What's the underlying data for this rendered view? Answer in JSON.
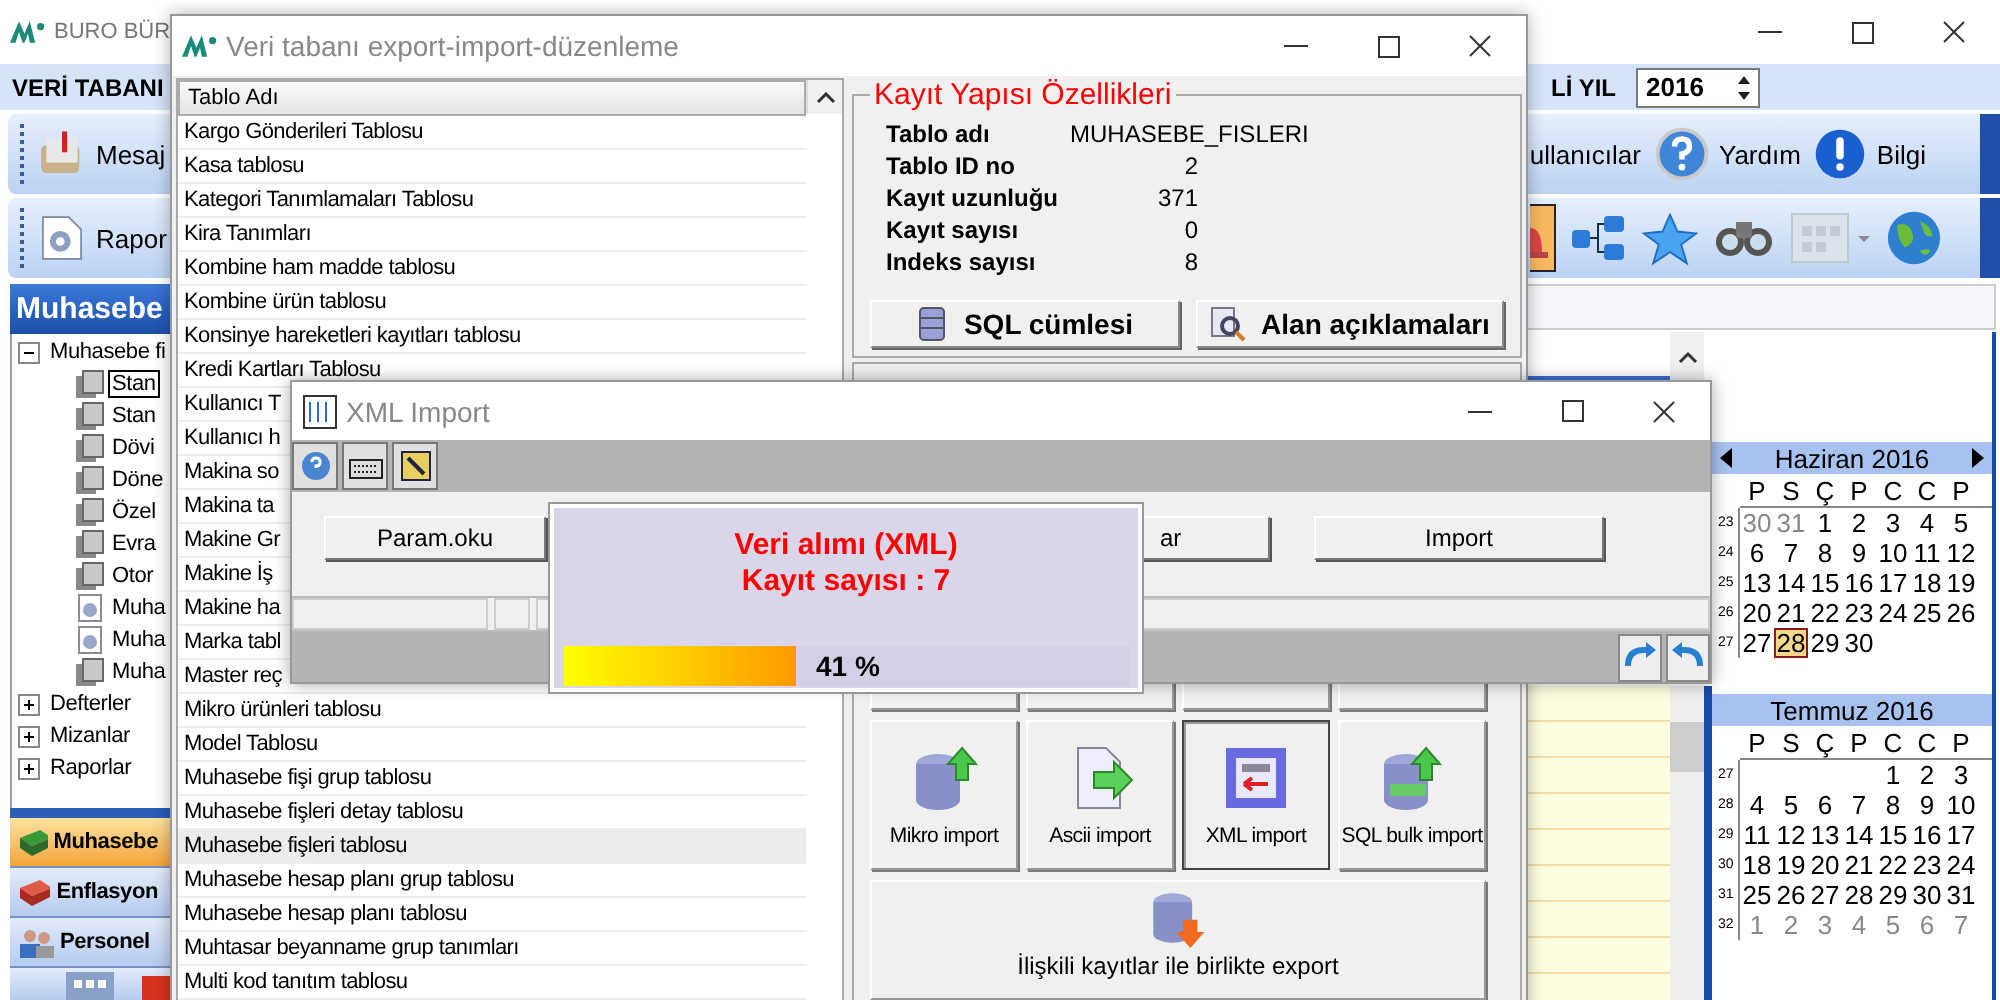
{
  "main_window": {
    "title": "BURO BÜR",
    "menu_label": "VERİ TABANI",
    "year_label": "Lİ YIL",
    "year": "2016",
    "toolbar_left": "Mesaj",
    "toolbar_right": [
      "ullanıcılar",
      "Yardım",
      "Bilgi"
    ],
    "toolbar2_left": "Rapor",
    "toolbar2_icons": [
      {
        "kind": "bell",
        "selected": true
      },
      {
        "kind": "tree",
        "selected": false
      },
      {
        "kind": "star",
        "selected": false
      },
      {
        "kind": "binoculars",
        "selected": false
      },
      {
        "kind": "calendar",
        "selected": false
      },
      {
        "kind": "globe",
        "selected": false
      }
    ],
    "panel_title": "Muhasebe",
    "tree": [
      {
        "label": "Muhasebe fi",
        "expanded": true,
        "selected": false,
        "children": [
          {
            "label": "Stan",
            "kind": "table",
            "selected": true
          },
          {
            "label": "Stan",
            "kind": "table",
            "selected": false
          },
          {
            "label": "Dövi",
            "kind": "table",
            "selected": false
          },
          {
            "label": "Döne",
            "kind": "table",
            "selected": false
          },
          {
            "label": "Özel",
            "kind": "table",
            "selected": false
          },
          {
            "label": "Evra",
            "kind": "table",
            "selected": false
          },
          {
            "label": "Otor",
            "kind": "table",
            "selected": false
          },
          {
            "label": "Muha",
            "kind": "report",
            "selected": false
          },
          {
            "label": "Muha",
            "kind": "report",
            "selected": false
          },
          {
            "label": "Muha",
            "kind": "table",
            "selected": false
          }
        ]
      },
      {
        "label": "Defterler",
        "expanded": false,
        "selected": false
      },
      {
        "label": "Mizanlar",
        "expanded": false,
        "selected": false
      },
      {
        "label": "Raporlar",
        "expanded": false,
        "selected": false
      }
    ],
    "nav": [
      {
        "label": "Muhasebe",
        "kind": "green-book",
        "selected": true
      },
      {
        "label": "Enflasyon",
        "kind": "red-book",
        "selected": false
      },
      {
        "label": "Personel",
        "kind": "people",
        "selected": false
      }
    ],
    "calendar": {
      "months": [
        {
          "title": "Haziran 2016",
          "nav": true,
          "weekdays": [
            "P",
            "S",
            "Ç",
            "P",
            "C",
            "C",
            "P"
          ],
          "weeks": [
            {
              "no": "23",
              "days": [
                {
                  "t": "30",
                  "muted": true,
                  "selected": false
                },
                {
                  "t": "31",
                  "muted": true,
                  "selected": false
                },
                {
                  "t": "1",
                  "muted": false,
                  "selected": false
                },
                {
                  "t": "2",
                  "muted": false,
                  "selected": false
                },
                {
                  "t": "3",
                  "muted": false,
                  "selected": false
                },
                {
                  "t": "4",
                  "muted": false,
                  "selected": false
                },
                {
                  "t": "5",
                  "muted": false,
                  "selected": false
                }
              ]
            },
            {
              "no": "24",
              "days": [
                {
                  "t": "6",
                  "muted": false,
                  "selected": false
                },
                {
                  "t": "7",
                  "muted": false,
                  "selected": false
                },
                {
                  "t": "8",
                  "muted": false,
                  "selected": false
                },
                {
                  "t": "9",
                  "muted": false,
                  "selected": false
                },
                {
                  "t": "10",
                  "muted": false,
                  "selected": false
                },
                {
                  "t": "11",
                  "muted": false,
                  "selected": false
                },
                {
                  "t": "12",
                  "muted": false,
                  "selected": false
                }
              ]
            },
            {
              "no": "25",
              "days": [
                {
                  "t": "13",
                  "muted": false,
                  "selected": false
                },
                {
                  "t": "14",
                  "muted": false,
                  "selected": false
                },
                {
                  "t": "15",
                  "muted": false,
                  "selected": false
                },
                {
                  "t": "16",
                  "muted": false,
                  "selected": false
                },
                {
                  "t": "17",
                  "muted": false,
                  "selected": false
                },
                {
                  "t": "18",
                  "muted": false,
                  "selected": false
                },
                {
                  "t": "19",
                  "muted": false,
                  "selected": false
                }
              ]
            },
            {
              "no": "26",
              "days": [
                {
                  "t": "20",
                  "muted": false,
                  "selected": false
                },
                {
                  "t": "21",
                  "muted": false,
                  "selected": false
                },
                {
                  "t": "22",
                  "muted": false,
                  "selected": false
                },
                {
                  "t": "23",
                  "muted": false,
                  "selected": false
                },
                {
                  "t": "24",
                  "muted": false,
                  "selected": false
                },
                {
                  "t": "25",
                  "muted": false,
                  "selected": false
                },
                {
                  "t": "26",
                  "muted": false,
                  "selected": false
                }
              ]
            },
            {
              "no": "27",
              "days": [
                {
                  "t": "27",
                  "muted": false,
                  "selected": false
                },
                {
                  "t": "28",
                  "muted": false,
                  "selected": true
                },
                {
                  "t": "29",
                  "muted": false,
                  "selected": false
                },
                {
                  "t": "30",
                  "muted": false,
                  "selected": false
                }
              ]
            }
          ]
        },
        {
          "title": "Temmuz 2016",
          "nav": false,
          "weekdays": [
            "P",
            "S",
            "Ç",
            "P",
            "C",
            "C",
            "P"
          ],
          "weeks": [
            {
              "no": "27",
              "days": [
                {
                  "t": "1",
                  "muted": false,
                  "selected": false
                },
                {
                  "t": "2",
                  "muted": false,
                  "selected": false
                },
                {
                  "t": "3",
                  "muted": false,
                  "selected": false
                }
              ]
            },
            {
              "no": "28",
              "days": [
                {
                  "t": "4",
                  "muted": false,
                  "selected": false
                },
                {
                  "t": "5",
                  "muted": false,
                  "selected": false
                },
                {
                  "t": "6",
                  "muted": false,
                  "selected": false
                },
                {
                  "t": "7",
                  "muted": false,
                  "selected": false
                },
                {
                  "t": "8",
                  "muted": false,
                  "selected": false
                },
                {
                  "t": "9",
                  "muted": false,
                  "selected": false
                },
                {
                  "t": "10",
                  "muted": false,
                  "selected": false
                }
              ]
            },
            {
              "no": "29",
              "days": [
                {
                  "t": "11",
                  "muted": false,
                  "selected": false
                },
                {
                  "t": "12",
                  "muted": false,
                  "selected": false
                },
                {
                  "t": "13",
                  "muted": false,
                  "selected": false
                },
                {
                  "t": "14",
                  "muted": false,
                  "selected": false
                },
                {
                  "t": "15",
                  "muted": false,
                  "selected": false
                },
                {
                  "t": "16",
                  "muted": false,
                  "selected": false
                },
                {
                  "t": "17",
                  "muted": false,
                  "selected": false
                }
              ]
            },
            {
              "no": "30",
              "days": [
                {
                  "t": "18",
                  "muted": false,
                  "selected": false
                },
                {
                  "t": "19",
                  "muted": false,
                  "selected": false
                },
                {
                  "t": "20",
                  "muted": false,
                  "selected": false
                },
                {
                  "t": "21",
                  "muted": false,
                  "selected": false
                },
                {
                  "t": "22",
                  "muted": false,
                  "selected": false
                },
                {
                  "t": "23",
                  "muted": false,
                  "selected": false
                },
                {
                  "t": "24",
                  "muted": false,
                  "selected": false
                }
              ]
            },
            {
              "no": "31",
              "days": [
                {
                  "t": "25",
                  "muted": false,
                  "selected": false
                },
                {
                  "t": "26",
                  "muted": false,
                  "selected": false
                },
                {
                  "t": "27",
                  "muted": false,
                  "selected": false
                },
                {
                  "t": "28",
                  "muted": false,
                  "selected": false
                },
                {
                  "t": "29",
                  "muted": false,
                  "selected": false
                },
                {
                  "t": "30",
                  "muted": false,
                  "selected": false
                },
                {
                  "t": "31",
                  "muted": false,
                  "selected": false
                }
              ]
            },
            {
              "no": "32",
              "days": [
                {
                  "t": "1",
                  "muted": true,
                  "selected": false
                },
                {
                  "t": "2",
                  "muted": true,
                  "selected": false
                },
                {
                  "t": "3",
                  "muted": true,
                  "selected": false
                },
                {
                  "t": "4",
                  "muted": true,
                  "selected": false
                },
                {
                  "t": "5",
                  "muted": true,
                  "selected": false
                },
                {
                  "t": "6",
                  "muted": true,
                  "selected": false
                },
                {
                  "t": "7",
                  "muted": true,
                  "selected": false
                }
              ]
            }
          ]
        }
      ]
    }
  },
  "export_window": {
    "title": "Veri tabanı export-import-düzenleme",
    "list_header": "Tablo Adı",
    "rows": [
      {
        "text": "Kargo Gönderileri Tablosu",
        "selected": false
      },
      {
        "text": "Kasa tablosu",
        "selected": false
      },
      {
        "text": "Kategori Tanımlamaları Tablosu",
        "selected": false
      },
      {
        "text": "Kira Tanımları",
        "selected": false
      },
      {
        "text": "Kombine ham madde tablosu",
        "selected": false
      },
      {
        "text": "Kombine ürün tablosu",
        "selected": false
      },
      {
        "text": "Konsinye hareketleri kayıtları tablosu",
        "selected": false
      },
      {
        "text": "Kredi Kartları Tablosu",
        "selected": false
      },
      {
        "text": "Kullanıcı T",
        "selected": false
      },
      {
        "text": "Kullanıcı h",
        "selected": false
      },
      {
        "text": "Makina so",
        "selected": false
      },
      {
        "text": "Makina ta",
        "selected": false
      },
      {
        "text": "Makine Gr",
        "selected": false
      },
      {
        "text": "Makine İş",
        "selected": false
      },
      {
        "text": "Makine ha",
        "selected": false
      },
      {
        "text": "Marka tabl",
        "selected": false
      },
      {
        "text": "Master reç",
        "selected": false
      },
      {
        "text": "Mikro ürünleri tablosu",
        "selected": false
      },
      {
        "text": "Model Tablosu",
        "selected": false
      },
      {
        "text": "Muhasebe fişi grup tablosu",
        "selected": false
      },
      {
        "text": "Muhasebe fişleri detay tablosu",
        "selected": false
      },
      {
        "text": "Muhasebe fişleri tablosu",
        "selected": true
      },
      {
        "text": "Muhasebe hesap planı grup tablosu",
        "selected": false
      },
      {
        "text": "Muhasebe hesap planı tablosu",
        "selected": false
      },
      {
        "text": "Muhtasar beyanname grup tanımları",
        "selected": false
      },
      {
        "text": "Multi kod tanıtım tablosu",
        "selected": false
      }
    ],
    "details_title": "Kayıt Yapısı Özellikleri",
    "props": [
      {
        "label": "Tablo adı",
        "value": "MUHASEBE_FISLERI",
        "kind": "text"
      },
      {
        "label": "Tablo ID no",
        "value": "2",
        "kind": "number"
      },
      {
        "label": "Kayıt uzunluğu",
        "value": "371",
        "kind": "number"
      },
      {
        "label": "Kayıt sayısı",
        "value": "0",
        "kind": "number"
      },
      {
        "label": "Indeks sayısı",
        "value": "8",
        "kind": "number"
      }
    ],
    "detail_buttons": [
      {
        "label": "SQL cümlesi",
        "kind": "sql"
      },
      {
        "label": "Alan açıklamaları",
        "kind": "fields"
      }
    ],
    "import_buttons": [
      {
        "label": "Mikro import",
        "kind": "db-up",
        "pressed": false
      },
      {
        "label": "Ascii import",
        "kind": "doc-arrow",
        "pressed": false
      },
      {
        "label": "XML import",
        "kind": "xml",
        "pressed": true
      },
      {
        "label": "SQL bulk import",
        "kind": "db-sql",
        "pressed": false
      }
    ],
    "export_button": "İlişkili kayıtlar ile birlikte export"
  },
  "xml_window": {
    "title": "XML Import",
    "buttons": [
      {
        "label": "Param.oku",
        "kind": "left"
      },
      {
        "label": "ar",
        "kind": "middle"
      },
      {
        "label": "Import",
        "kind": "right"
      }
    ]
  },
  "progress": {
    "lines": [
      "Veri alımı (XML)",
      "Kayıt sayısı : 7"
    ],
    "level": 0.41,
    "reading": "41 %"
  }
}
